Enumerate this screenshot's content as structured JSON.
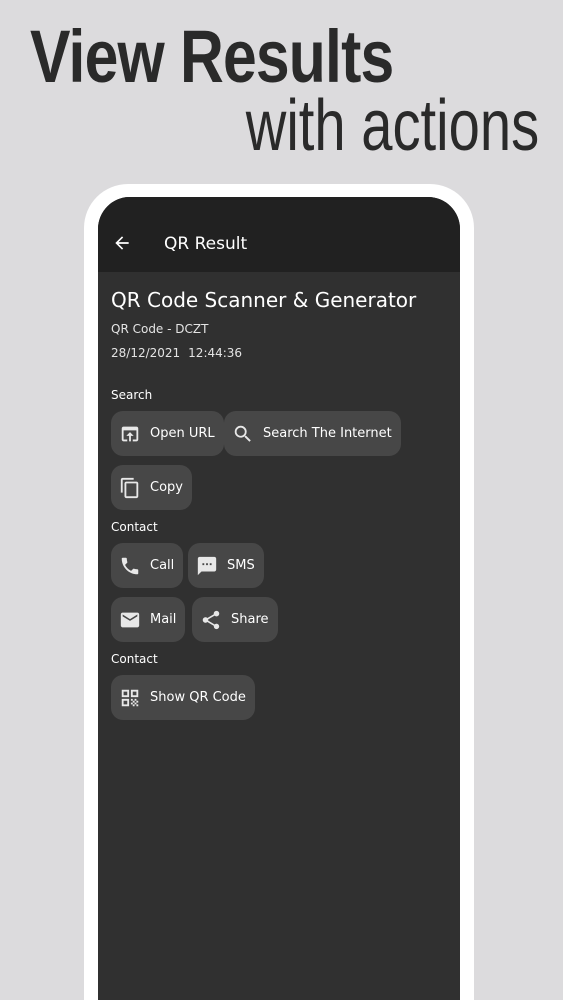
{
  "promo": {
    "title": "View Results",
    "subtitle": "with actions"
  },
  "app_bar": {
    "title": "QR Result",
    "back_icon": "arrow-back-icon"
  },
  "result": {
    "title": "QR Code Scanner & Generator",
    "type_line": "QR Code - DCZT",
    "date": "28/12/2021",
    "time": "12:44:36"
  },
  "sections": {
    "search": "Search",
    "contact": "Contact",
    "contact2": "Contact"
  },
  "actions": {
    "open_url": {
      "label": "Open URL",
      "icon": "open-in-browser-icon"
    },
    "search_internet": {
      "label": "Search The Internet",
      "icon": "search-icon"
    },
    "copy": {
      "label": "Copy",
      "icon": "copy-icon"
    },
    "call": {
      "label": "Call",
      "icon": "phone-icon"
    },
    "sms": {
      "label": "SMS",
      "icon": "sms-icon"
    },
    "mail": {
      "label": "Mail",
      "icon": "mail-icon"
    },
    "share": {
      "label": "Share",
      "icon": "share-icon"
    },
    "show_qr": {
      "label": "Show QR Code",
      "icon": "qr-code-icon"
    }
  },
  "colors": {
    "background": "#dcdbdd",
    "screen": "#303030",
    "app_bar": "#212121",
    "chip": "#474747"
  }
}
